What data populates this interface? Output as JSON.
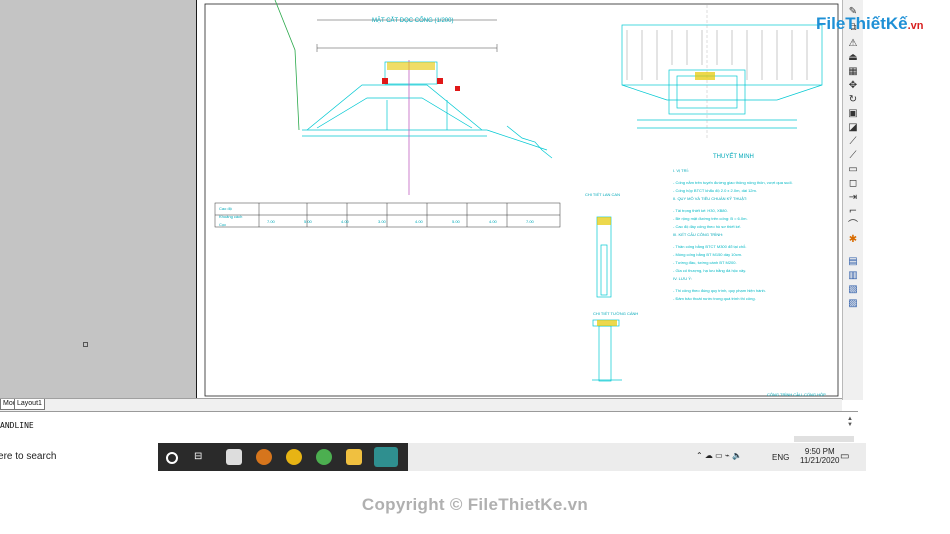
{
  "drawing": {
    "section_title": "MẶT CẮT DỌC CỐNG (1/200)",
    "notes_title": "THUYẾT MINH",
    "detail_title_1": "CHI TIẾT LAN CAN",
    "detail_title_2": "CHI TIẾT TƯỜNG CÁNH",
    "footer_note": "CÔNG TRÌNH CẦU, CỐNG HỘP",
    "notes": [
      "I. VỊ TRÍ:",
      "- Cống nằm trên tuyến đường giao thông nông thôn, vượt qua suối.",
      "- Cống hộp BTCT khẩu độ 2.0 x 2.0m, dài 12m.",
      "II. QUY MÔ VÀ TIÊU CHUẨN KỸ THUẬT:",
      "- Tải trọng thiết kế: H30, XB80.",
      "- Bề rộng mặt đường trên cống: B = 6.0m.",
      "- Cao độ đáy cống theo hồ sơ thiết kế.",
      "III. KẾT CẤU CÔNG TRÌNH:",
      "- Thân cống bằng BTCT M300 đổ tại chỗ.",
      "- Móng cống bằng BT M150 dày 10cm.",
      "- Tường đầu, tường cánh BT M200.",
      "- Gia cố thượng, hạ lưu bằng đá hộc xây.",
      "IV. LƯU Ý:",
      "- Thi công theo đúng quy trình, quy phạm hiện hành.",
      "- Đảm bảo thoát nước trong quá trình thi công."
    ],
    "table_headers": [
      "Cao độ",
      "Khoảng cách",
      "Cọc"
    ],
    "table_values": [
      "7.00",
      "5.00",
      "4.00",
      "3.00",
      "4.00",
      "5.00",
      "4.00",
      "7.00"
    ]
  },
  "tabs": [
    "Model",
    "Layout1"
  ],
  "command_line": "ANDLINE",
  "taskbar": {
    "search_placeholder": "Type here to search",
    "language": "ENG",
    "time": "9:50 PM",
    "date": "11/21/2020"
  },
  "watermark": {
    "logo": "FileThiếtKế",
    "logo_suffix": ".vn",
    "copyright": "Copyright © FileThietKe.vn"
  },
  "colors": {
    "drawing_line": "#00c8d2",
    "accent_red": "#e01818",
    "yellow": "#e6c700"
  }
}
